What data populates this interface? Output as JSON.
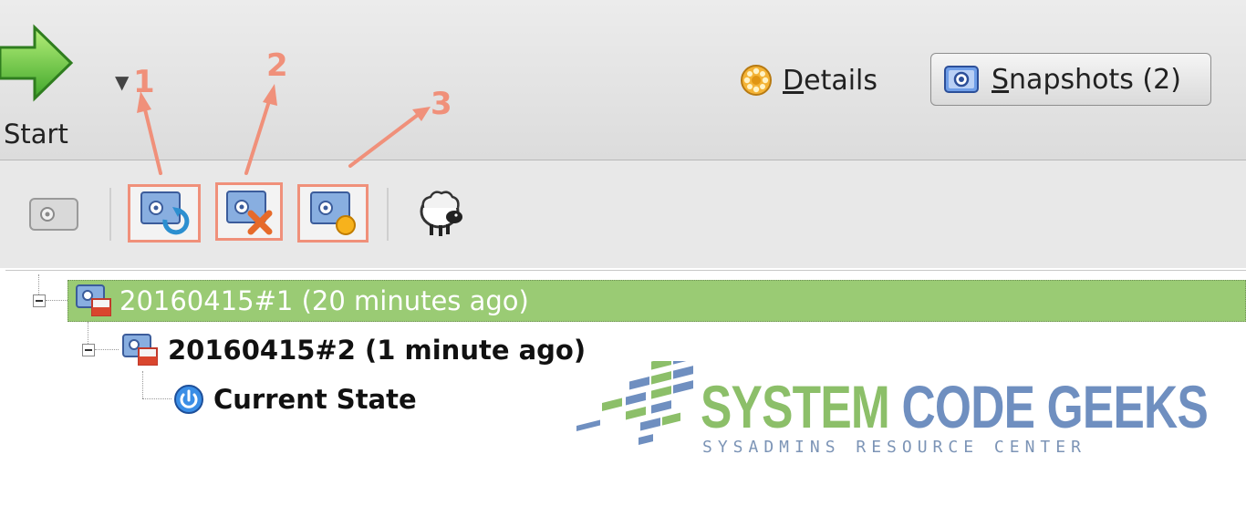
{
  "toolbar": {
    "start_label": "Start",
    "details_label": "Details",
    "snapshots_label": "Snapshots (2)"
  },
  "annotations": [
    "1",
    "2",
    "3"
  ],
  "tree": {
    "items": [
      {
        "label": "20160415#1 (20 minutes ago)",
        "selected": true
      },
      {
        "label": "20160415#2 (1 minute ago)"
      },
      {
        "label": "Current State"
      }
    ]
  },
  "watermark": {
    "title_part1": "SYSTEM",
    "title_part2": "CODE GEEKS",
    "subtitle": "SYSADMINS RESOURCE CENTER"
  },
  "colors": {
    "selection": "#9acb74",
    "annotation": "#f0907a",
    "watermark_green": "#8cbf69",
    "watermark_blue": "#6f8fc0"
  }
}
